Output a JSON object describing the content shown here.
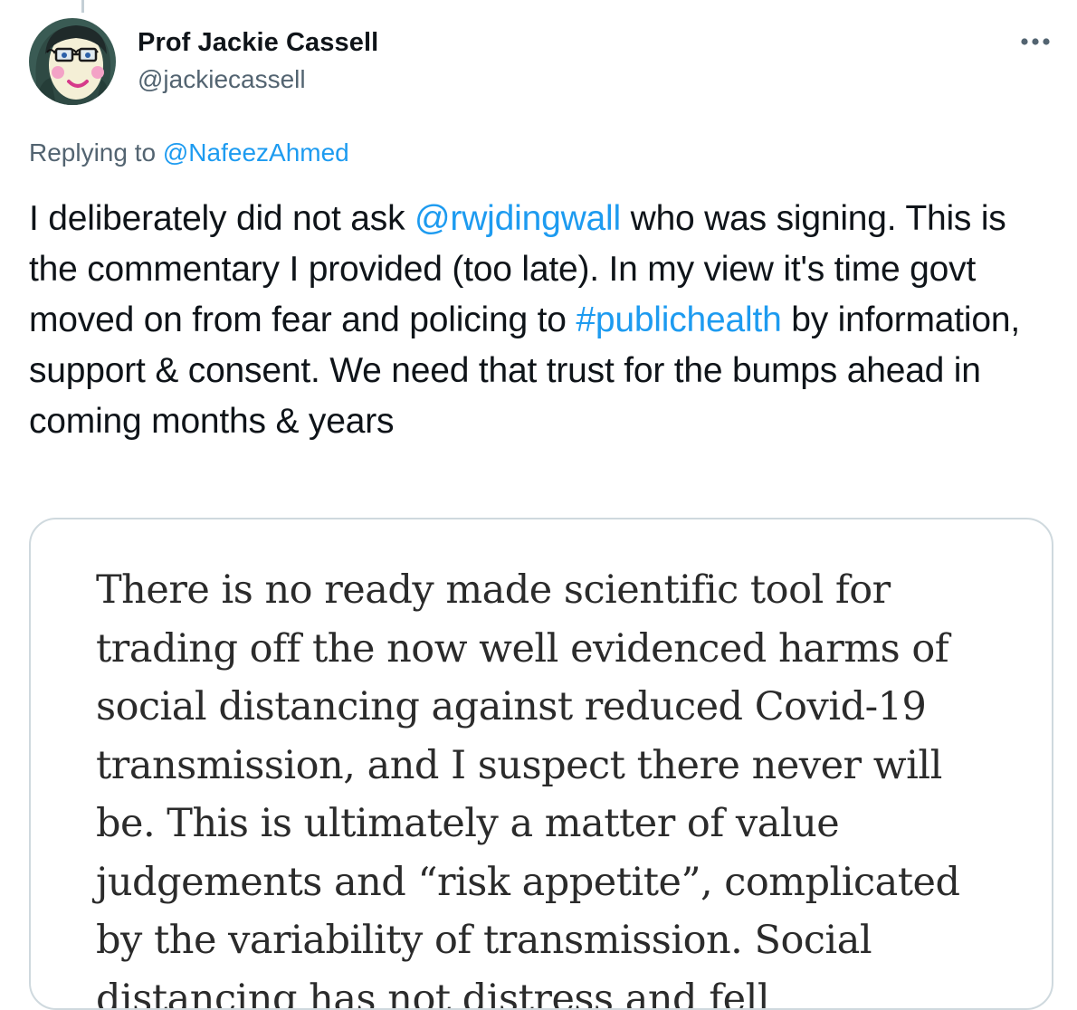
{
  "author": {
    "display_name": "Prof Jackie Cassell",
    "handle": "@jackiecassell",
    "avatar_icon": "cartoon-avatar-icon"
  },
  "more_icon": "more-horizontal-icon",
  "reply_context": {
    "prefix": "Replying to ",
    "mention": "@NafeezAhmed"
  },
  "tweet": {
    "part1": "I deliberately did not ask ",
    "mention": "@rwjdingwall",
    "part2": " who was signing. This is the commentary I provided (too late).  In my view it's time govt moved on from fear and policing to ",
    "hashtag": "#publichealth",
    "part3": " by information, support & consent. We need that trust for the bumps ahead in coming months & years"
  },
  "media": {
    "text": "There is no ready made scientific tool for trading off the now well evidenced harms of social distancing against reduced Covid-19 transmission, and I suspect there never will be.  This is ultimately a matter of value judgements and “risk appetite”, complicated by the variability of transmission.  Social distancing has not distress and fell"
  },
  "colors": {
    "link": "#1d9bf0",
    "secondary_text": "#536471",
    "primary_text": "#0f1419",
    "card_border": "#cfd9de"
  }
}
